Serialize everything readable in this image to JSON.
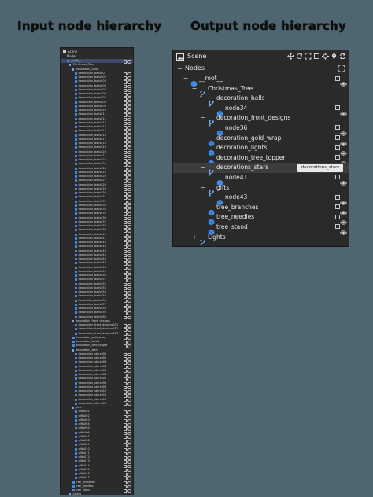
{
  "headings": {
    "input": "Input node hierarchy",
    "output": "Output node hierarchy"
  },
  "left_panel": {
    "title": "Scene",
    "nodes_label": "Nodes",
    "rows": [
      {
        "d": 1,
        "t": "__root__",
        "i": "node"
      },
      {
        "d": 2,
        "t": "Christmas_Tree",
        "i": "fork"
      },
      {
        "d": 3,
        "t": "decoration_balls",
        "i": "fork"
      },
      {
        "d": 4,
        "t": "decoration_balls001",
        "i": "node"
      },
      {
        "d": 4,
        "t": "decoration_balls002",
        "i": "node"
      },
      {
        "d": 4,
        "t": "decoration_balls003",
        "i": "node"
      },
      {
        "d": 4,
        "t": "decoration_balls004",
        "i": "node"
      },
      {
        "d": 4,
        "t": "decoration_balls005",
        "i": "node"
      },
      {
        "d": 4,
        "t": "decoration_balls006",
        "i": "node"
      },
      {
        "d": 4,
        "t": "decoration_balls007",
        "i": "node"
      },
      {
        "d": 4,
        "t": "decoration_balls008",
        "i": "node"
      },
      {
        "d": 4,
        "t": "decoration_balls009",
        "i": "node"
      },
      {
        "d": 4,
        "t": "decoration_balls010",
        "i": "node"
      },
      {
        "d": 4,
        "t": "decoration_balls011",
        "i": "node"
      },
      {
        "d": 4,
        "t": "decoration_balls012",
        "i": "node"
      },
      {
        "d": 4,
        "t": "decoration_balls013",
        "i": "node"
      },
      {
        "d": 4,
        "t": "decoration_balls014",
        "i": "node"
      },
      {
        "d": 4,
        "t": "decoration_balls015",
        "i": "node"
      },
      {
        "d": 4,
        "t": "decoration_balls016",
        "i": "node"
      },
      {
        "d": 4,
        "t": "decoration_balls017",
        "i": "node"
      },
      {
        "d": 4,
        "t": "decoration_balls018",
        "i": "node"
      },
      {
        "d": 4,
        "t": "decoration_balls019",
        "i": "node"
      },
      {
        "d": 4,
        "t": "decoration_balls020",
        "i": "node"
      },
      {
        "d": 4,
        "t": "decoration_balls021",
        "i": "node"
      },
      {
        "d": 4,
        "t": "decoration_balls022",
        "i": "node"
      },
      {
        "d": 4,
        "t": "decoration_balls023",
        "i": "node"
      },
      {
        "d": 4,
        "t": "decoration_balls024",
        "i": "node"
      },
      {
        "d": 4,
        "t": "decoration_balls025",
        "i": "node"
      },
      {
        "d": 4,
        "t": "decoration_balls026",
        "i": "node"
      },
      {
        "d": 4,
        "t": "decoration_balls027",
        "i": "node"
      },
      {
        "d": 4,
        "t": "decoration_balls028",
        "i": "node"
      },
      {
        "d": 4,
        "t": "decoration_balls029",
        "i": "node"
      },
      {
        "d": 4,
        "t": "decoration_balls030",
        "i": "node"
      },
      {
        "d": 4,
        "t": "decoration_balls031",
        "i": "node"
      },
      {
        "d": 4,
        "t": "decoration_balls032",
        "i": "node"
      },
      {
        "d": 4,
        "t": "decoration_balls033",
        "i": "node"
      },
      {
        "d": 4,
        "t": "decoration_balls034",
        "i": "node"
      },
      {
        "d": 4,
        "t": "decoration_balls035",
        "i": "node"
      },
      {
        "d": 4,
        "t": "decoration_balls036",
        "i": "node"
      },
      {
        "d": 4,
        "t": "decoration_balls037",
        "i": "node"
      },
      {
        "d": 4,
        "t": "decoration_balls038",
        "i": "node"
      },
      {
        "d": 4,
        "t": "decoration_balls039",
        "i": "node"
      },
      {
        "d": 4,
        "t": "decoration_balls040",
        "i": "node"
      },
      {
        "d": 4,
        "t": "decoration_balls041",
        "i": "node"
      },
      {
        "d": 4,
        "t": "decoration_balls042",
        "i": "node"
      },
      {
        "d": 4,
        "t": "decoration_balls043",
        "i": "node"
      },
      {
        "d": 4,
        "t": "decoration_balls044",
        "i": "node"
      },
      {
        "d": 4,
        "t": "decoration_balls045",
        "i": "node"
      },
      {
        "d": 4,
        "t": "decoration_balls046",
        "i": "node"
      },
      {
        "d": 4,
        "t": "decoration_balls047",
        "i": "node"
      },
      {
        "d": 4,
        "t": "decoration_balls048",
        "i": "node"
      },
      {
        "d": 4,
        "t": "decoration_balls049",
        "i": "node"
      },
      {
        "d": 4,
        "t": "decoration_balls050",
        "i": "node"
      },
      {
        "d": 4,
        "t": "decoration_balls051",
        "i": "node"
      },
      {
        "d": 4,
        "t": "decoration_balls052",
        "i": "node"
      },
      {
        "d": 4,
        "t": "decoration_balls053",
        "i": "node"
      },
      {
        "d": 4,
        "t": "decoration_balls054",
        "i": "node"
      },
      {
        "d": 4,
        "t": "decoration_balls055",
        "i": "node"
      },
      {
        "d": 4,
        "t": "decoration_balls056",
        "i": "node"
      },
      {
        "d": 4,
        "t": "decoration_balls057",
        "i": "node"
      },
      {
        "d": 4,
        "t": "decoration_balls058",
        "i": "node"
      },
      {
        "d": 4,
        "t": "decoration_balls059",
        "i": "node"
      },
      {
        "d": 4,
        "t": "decoration_balls060",
        "i": "node"
      },
      {
        "d": 3,
        "t": "decoration_front_designs",
        "i": "fork"
      },
      {
        "d": 4,
        "t": "decoration_front_designs001",
        "i": "node"
      },
      {
        "d": 4,
        "t": "decoration_front_designs002",
        "i": "node"
      },
      {
        "d": 4,
        "t": "decoration_front_designs003",
        "i": "node"
      },
      {
        "d": 3,
        "t": "decoration_gold_wrap",
        "i": "node"
      },
      {
        "d": 3,
        "t": "decoration_lights",
        "i": "node"
      },
      {
        "d": 3,
        "t": "decoration_tree_topper",
        "i": "node"
      },
      {
        "d": 3,
        "t": "decoration_stars",
        "i": "fork"
      },
      {
        "d": 4,
        "t": "decoration_stars001",
        "i": "node"
      },
      {
        "d": 4,
        "t": "decoration_stars002",
        "i": "node"
      },
      {
        "d": 4,
        "t": "decoration_stars003",
        "i": "node"
      },
      {
        "d": 4,
        "t": "decoration_stars004",
        "i": "node"
      },
      {
        "d": 4,
        "t": "decoration_stars005",
        "i": "node"
      },
      {
        "d": 4,
        "t": "decoration_stars006",
        "i": "node"
      },
      {
        "d": 4,
        "t": "decoration_stars007",
        "i": "node"
      },
      {
        "d": 4,
        "t": "decoration_stars008",
        "i": "node"
      },
      {
        "d": 4,
        "t": "decoration_stars009",
        "i": "node"
      },
      {
        "d": 4,
        "t": "decoration_stars010",
        "i": "node"
      },
      {
        "d": 4,
        "t": "decoration_stars011",
        "i": "node"
      },
      {
        "d": 4,
        "t": "decoration_stars012",
        "i": "node"
      },
      {
        "d": 4,
        "t": "decoration_stars013",
        "i": "node"
      },
      {
        "d": 3,
        "t": "gifts",
        "i": "fork"
      },
      {
        "d": 4,
        "t": "gifts001",
        "i": "node"
      },
      {
        "d": 4,
        "t": "gifts002",
        "i": "node"
      },
      {
        "d": 4,
        "t": "gifts003",
        "i": "node"
      },
      {
        "d": 4,
        "t": "gifts004",
        "i": "node"
      },
      {
        "d": 4,
        "t": "gifts005",
        "i": "node"
      },
      {
        "d": 4,
        "t": "gifts006",
        "i": "node"
      },
      {
        "d": 4,
        "t": "gifts007",
        "i": "node"
      },
      {
        "d": 4,
        "t": "gifts008",
        "i": "node"
      },
      {
        "d": 4,
        "t": "gifts009",
        "i": "node"
      },
      {
        "d": 4,
        "t": "gifts010",
        "i": "node"
      },
      {
        "d": 4,
        "t": "gifts011",
        "i": "node"
      },
      {
        "d": 4,
        "t": "gifts012",
        "i": "node"
      },
      {
        "d": 4,
        "t": "gifts013",
        "i": "node"
      },
      {
        "d": 4,
        "t": "gifts014",
        "i": "node"
      },
      {
        "d": 4,
        "t": "gifts015",
        "i": "node"
      },
      {
        "d": 4,
        "t": "gifts016",
        "i": "node"
      },
      {
        "d": 4,
        "t": "gifts017",
        "i": "node"
      },
      {
        "d": 3,
        "t": "tree_branches",
        "i": "node"
      },
      {
        "d": 3,
        "t": "tree_needles",
        "i": "node"
      },
      {
        "d": 3,
        "t": "tree_stand",
        "i": "node"
      },
      {
        "d": 2,
        "t": "Lights",
        "i": "fork"
      }
    ]
  },
  "scene": {
    "title": "Scene",
    "nodes_label": "Nodes",
    "tooltip": "decorations_stars",
    "tree": [
      {
        "label": "__root__",
        "depth": 0,
        "toggle": "−",
        "icon": "node",
        "vis": true
      },
      {
        "label": "Christmas_Tree",
        "depth": 1,
        "toggle": "−",
        "icon": "fork",
        "vis": false
      },
      {
        "label": "decoration_balls",
        "depth": 2,
        "toggle": "−",
        "icon": "fork",
        "vis": false
      },
      {
        "label": "node34",
        "depth": 3,
        "toggle": "",
        "icon": "node",
        "vis": true
      },
      {
        "label": "decoration_front_designs",
        "depth": 2,
        "toggle": "−",
        "icon": "fork",
        "vis": false
      },
      {
        "label": "node36",
        "depth": 3,
        "toggle": "",
        "icon": "node",
        "vis": true
      },
      {
        "label": "decoration_gold_wrap",
        "depth": 2,
        "toggle": "",
        "icon": "node",
        "vis": true
      },
      {
        "label": "decoration_lights",
        "depth": 2,
        "toggle": "",
        "icon": "node",
        "vis": true
      },
      {
        "label": "decoration_tree_topper",
        "depth": 2,
        "toggle": "",
        "icon": "node",
        "vis": true
      },
      {
        "label": "decorations_stars",
        "depth": 2,
        "toggle": "−",
        "icon": "fork",
        "vis": false,
        "highlight": true
      },
      {
        "label": "node41",
        "depth": 3,
        "toggle": "",
        "icon": "node",
        "vis": true
      },
      {
        "label": "gifts",
        "depth": 2,
        "toggle": "−",
        "icon": "fork",
        "vis": false
      },
      {
        "label": "node43",
        "depth": 3,
        "toggle": "",
        "icon": "node",
        "vis": true
      },
      {
        "label": "tree_branches",
        "depth": 2,
        "toggle": "",
        "icon": "node",
        "vis": true
      },
      {
        "label": "tree_needles",
        "depth": 2,
        "toggle": "",
        "icon": "node",
        "vis": true
      },
      {
        "label": "tree_stand",
        "depth": 2,
        "toggle": "",
        "icon": "node",
        "vis": true
      },
      {
        "label": "Lights",
        "depth": 1,
        "toggle": "+",
        "icon": "fork",
        "vis": false
      }
    ]
  },
  "colors": {
    "background": "#4f6570",
    "panel": "#2a2a2a",
    "node_icon": "#3f8ee8",
    "fork_icon": "#7aa9f0",
    "highlight_row": "#3d3d3d",
    "tooltip_bg": "#e9e9e9"
  }
}
